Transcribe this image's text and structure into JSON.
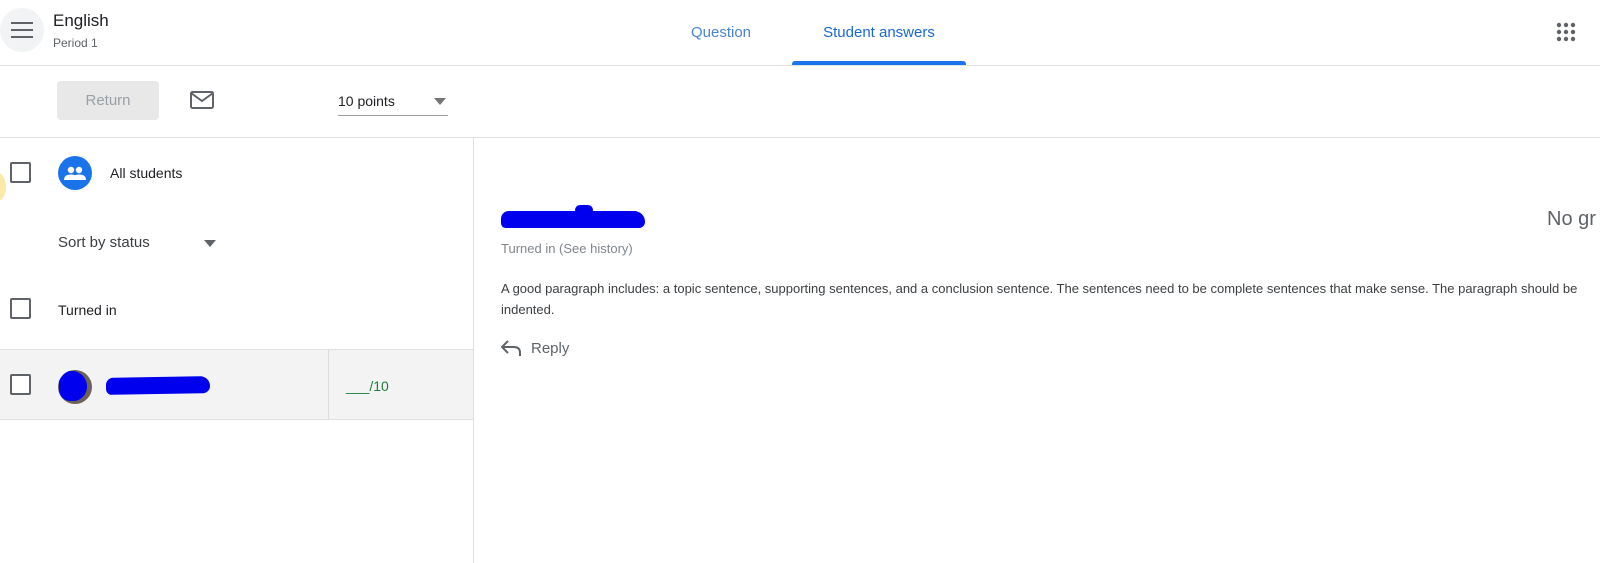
{
  "header": {
    "class_title": "English",
    "class_subtitle": "Period 1",
    "tabs": [
      {
        "label": "Question",
        "active": false
      },
      {
        "label": "Student answers",
        "active": true
      }
    ],
    "menu_icon": "hamburger-menu-icon",
    "apps_icon": "apps-grid-icon"
  },
  "toolbar": {
    "return_label": "Return",
    "mail_icon": "email-icon",
    "points_value": "10 points"
  },
  "students_panel": {
    "all_students_label": "All students",
    "sort_label": "Sort by status",
    "group_label": "Turned in",
    "rows": [
      {
        "grade": "___/10"
      }
    ]
  },
  "answer_panel": {
    "grade_status": "No gr",
    "turnin_status": "Turned in (See history)",
    "answer_text": "A good paragraph includes: a topic sentence, supporting sentences, and a conclusion sentence. The sentences need to be complete sentences that make sense. The paragraph should be indented.",
    "reply_label": "Reply"
  },
  "colors": {
    "accent": "#1a73e8",
    "tab_active_text": "#1967d2",
    "grade_green": "#188038",
    "redaction": "#0000ee"
  }
}
